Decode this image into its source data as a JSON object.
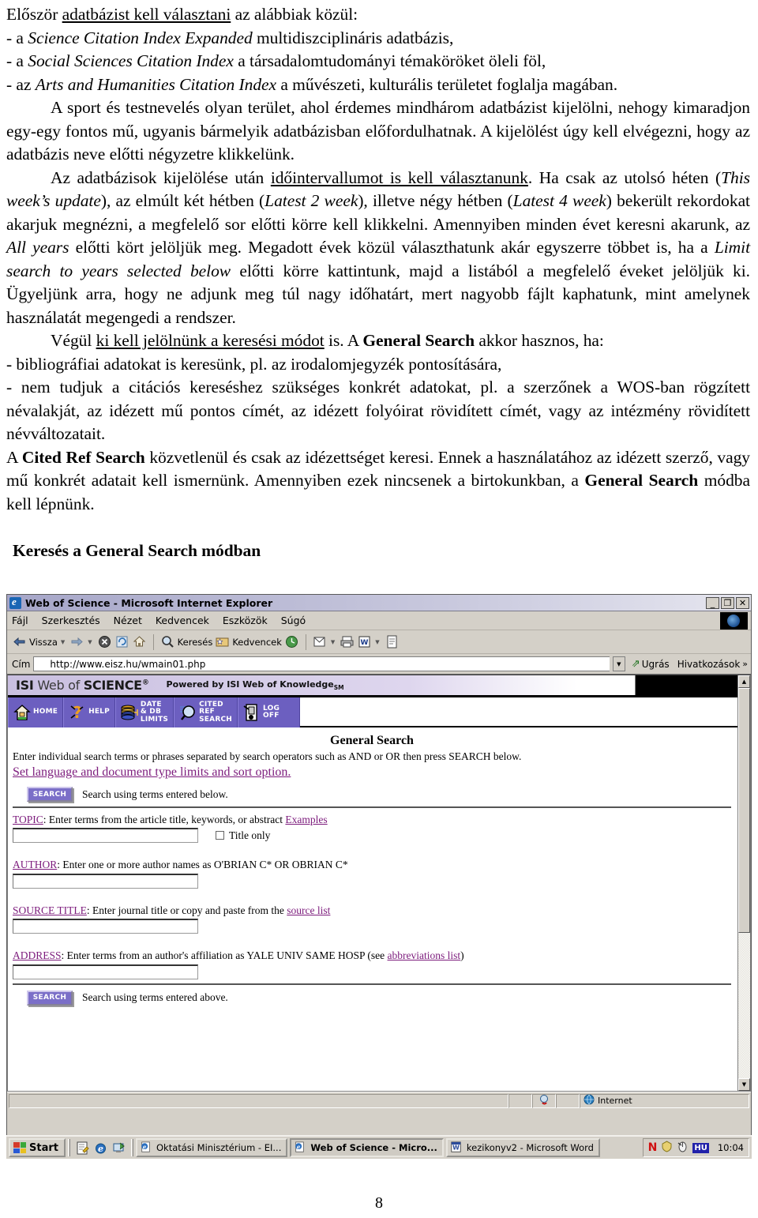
{
  "document": {
    "paragraphs": [
      {
        "id": "p1",
        "runs": [
          {
            "t": "Először ",
            "s": "n"
          },
          {
            "t": "adatbázist kell választani",
            "s": "u"
          },
          {
            "t": " az alábbiak közül:",
            "s": "n"
          }
        ]
      },
      {
        "id": "p2",
        "runs": [
          {
            "t": "- a ",
            "s": "n"
          },
          {
            "t": "Science Citation Index Expanded",
            "s": "i"
          },
          {
            "t": " multidiszciplináris adatbázis,",
            "s": "n"
          }
        ]
      },
      {
        "id": "p3",
        "runs": [
          {
            "t": "- a ",
            "s": "n"
          },
          {
            "t": "Social Sciences Citation Index",
            "s": "i"
          },
          {
            "t": " a társadalomtudományi témaköröket öleli föl,",
            "s": "n"
          }
        ]
      },
      {
        "id": "p4",
        "runs": [
          {
            "t": "- az ",
            "s": "n"
          },
          {
            "t": "Arts and Humanities Citation Index",
            "s": "i"
          },
          {
            "t": " a művészeti, kulturális területet foglalja magában.",
            "s": "n"
          }
        ]
      },
      {
        "id": "p5",
        "indent": true,
        "runs": [
          {
            "t": "A sport és testnevelés olyan terület, ahol érdemes mindhárom adatbázist kijelölni, nehogy kimaradjon egy-egy fontos mű, ugyanis bármelyik adatbázisban előfordulhatnak. A kijelölést úgy kell elvégezni, hogy az adatbázis neve előtti négyzetre klikkelünk.",
            "s": "n"
          }
        ]
      },
      {
        "id": "p6",
        "indent": true,
        "runs": [
          {
            "t": "Az adatbázisok kijelölése után ",
            "s": "n"
          },
          {
            "t": "időintervallumot is kell választanunk",
            "s": "u"
          },
          {
            "t": ". Ha csak az utolsó héten (",
            "s": "n"
          },
          {
            "t": "This week’s update",
            "s": "i"
          },
          {
            "t": "), az elmúlt két hétben (",
            "s": "n"
          },
          {
            "t": "Latest 2 week",
            "s": "i"
          },
          {
            "t": "), illetve négy hétben (",
            "s": "n"
          },
          {
            "t": "Latest 4 week",
            "s": "i"
          },
          {
            "t": ") bekerült rekordokat akarjuk megnézni, a megfelelő sor előtti körre kell klikkelni. Amennyiben minden évet keresni akarunk, az ",
            "s": "n"
          },
          {
            "t": "All years",
            "s": "i"
          },
          {
            "t": " előtti kört jelöljük meg. Megadott évek közül választhatunk akár egyszerre többet is, ha a ",
            "s": "n"
          },
          {
            "t": "Limit search to years selected below",
            "s": "i"
          },
          {
            "t": " előtti körre kattintunk, majd a listából a megfelelő éveket jelöljük ki. Ügyeljünk arra, hogy ne adjunk meg túl nagy időhatárt, mert nagyobb fájlt kaphatunk, mint amelynek használatát megengedi a rendszer.",
            "s": "n"
          }
        ]
      },
      {
        "id": "p7",
        "indent": true,
        "runs": [
          {
            "t": "Végül ",
            "s": "n"
          },
          {
            "t": "ki kell jelölnünk a keresési módot",
            "s": "u"
          },
          {
            "t": " is. A ",
            "s": "n"
          },
          {
            "t": "General Search",
            "s": "b"
          },
          {
            "t": " akkor hasznos, ha:",
            "s": "n"
          }
        ]
      },
      {
        "id": "p8",
        "runs": [
          {
            "t": "- bibliográfiai adatokat is keresünk, pl. az irodalomjegyzék pontosítására,",
            "s": "n"
          }
        ]
      },
      {
        "id": "p9",
        "runs": [
          {
            "t": "- nem tudjuk a citációs kereséshez szükséges konkrét adatokat, pl. a szerzőnek a WOS-ban rögzített névalakját, az idézett mű pontos címét, az idézett folyóirat rövidített címét, vagy az intézmény rövidített névváltozatait.",
            "s": "n"
          }
        ]
      },
      {
        "id": "p10",
        "runs": [
          {
            "t": "A ",
            "s": "n"
          },
          {
            "t": "Cited Ref Search",
            "s": "b"
          },
          {
            "t": " közvetlenül és csak az idézettséget keresi. Ennek a használatához az idézett szerző, vagy mű konkrét adatait kell ismernünk. Amennyiben ezek nincsenek a birtokunkban, a ",
            "s": "n"
          },
          {
            "t": "General Search",
            "s": "b"
          },
          {
            "t": " módba kell lépnünk.",
            "s": "n"
          }
        ]
      }
    ],
    "section_heading": "Keresés a General Search módban",
    "page_number": "8"
  },
  "browser": {
    "title": "Web of Science - Microsoft Internet Explorer",
    "window_buttons": {
      "minimize": "_",
      "restore": "❐",
      "close": "✕"
    },
    "menus": [
      "Fájl",
      "Szerkesztés",
      "Nézet",
      "Kedvencek",
      "Eszközök",
      "Súgó"
    ],
    "toolbar": [
      {
        "name": "back-button",
        "label": "Vissza",
        "icon": "arrow-left-icon",
        "dropdown": true
      },
      {
        "name": "forward-button",
        "label": "",
        "icon": "arrow-right-icon",
        "dropdown": true
      },
      {
        "name": "stop-button",
        "label": "",
        "icon": "stop-icon",
        "dropdown": false
      },
      {
        "name": "refresh-button",
        "label": "",
        "icon": "refresh-icon",
        "dropdown": false
      },
      {
        "name": "home-button",
        "label": "",
        "icon": "home-icon",
        "dropdown": false
      },
      {
        "name": "search-button",
        "label": "Keresés",
        "icon": "search-icon",
        "dropdown": false
      },
      {
        "name": "favorites-button",
        "label": "Kedvencek",
        "icon": "star-folder-icon",
        "dropdown": false
      },
      {
        "name": "history-button",
        "label": "",
        "icon": "history-icon",
        "dropdown": false
      },
      {
        "name": "mail-button",
        "label": "",
        "icon": "mail-icon",
        "dropdown": true
      },
      {
        "name": "print-button",
        "label": "",
        "icon": "printer-icon",
        "dropdown": false
      },
      {
        "name": "edit-word-button",
        "label": "",
        "icon": "word-icon",
        "dropdown": true
      },
      {
        "name": "discuss-button",
        "label": "",
        "icon": "page-icon",
        "dropdown": false
      }
    ],
    "address": {
      "label": "Cím",
      "value": "http://www.eisz.hu/wmain01.php",
      "go_label": "Ugrás",
      "links_label": "Hivatkozások"
    },
    "statusbar": {
      "message": "",
      "zone": "Internet"
    }
  },
  "wos": {
    "brand_isi": "ISI",
    "brand_web_of": " Web of ",
    "brand_science": "SCIENCE",
    "brand_reg": "®",
    "powered_by": "Powered by ISI Web of Knowledge",
    "powered_sm": "SM",
    "nav": [
      {
        "name": "home",
        "label": "HOME",
        "icon": "home-icon"
      },
      {
        "name": "help",
        "label": "HELP",
        "icon": "question-mark-icon"
      },
      {
        "name": "date-db-limits",
        "label": "DATE\n& DB\nLIMITS",
        "label_lines": [
          "DATE",
          "& DB",
          "LIMITS"
        ],
        "icon": "database-icon"
      },
      {
        "name": "cited-ref-search",
        "label_lines": [
          "CITED",
          "REF",
          "SEARCH"
        ],
        "icon": "magnifier-icon"
      },
      {
        "name": "log-off",
        "label": "LOG OFF",
        "icon": "door-exit-icon"
      }
    ],
    "page_title": "General Search",
    "instruction": "Enter individual search terms or phrases separated by search operators such as AND or OR then press SEARCH below.",
    "limits_link": "Set language and document type limits and sort option.",
    "search_button_top": {
      "label": "SEARCH",
      "note": "Search using terms entered below."
    },
    "search_button_bottom": {
      "label": "SEARCH",
      "note": "Search using terms entered above."
    },
    "fields": [
      {
        "name": "topic",
        "key": "TOPIC",
        "desc": ": Enter terms from the article title, keywords, or abstract ",
        "link": "Examples",
        "link_trail": "",
        "value": "",
        "checkbox": {
          "label": "Title only",
          "checked": false
        }
      },
      {
        "name": "author",
        "key": "AUTHOR",
        "desc": ": Enter one or more author names as O'BRIAN C* OR OBRIAN C*",
        "link": "",
        "link_trail": "",
        "value": "",
        "checkbox": null
      },
      {
        "name": "source-title",
        "key": "SOURCE TITLE",
        "desc": ": Enter journal title or copy and paste from the ",
        "link": "source list",
        "link_trail": "",
        "value": "",
        "checkbox": null
      },
      {
        "name": "address",
        "key": "ADDRESS",
        "desc": ": Enter terms from an author's affiliation as YALE UNIV SAME HOSP (see ",
        "link": "abbreviations list",
        "link_trail": ")",
        "value": "",
        "checkbox": null
      }
    ]
  },
  "taskbar": {
    "start_label": "Start",
    "quick_launch": [
      "notepad-icon",
      "internet-explorer-icon",
      "show-desktop-icon"
    ],
    "tasks": [
      {
        "label": "Oktatási Minisztérium - EI...",
        "icon": "internet-explorer-icon",
        "active": false
      },
      {
        "label": "Web of Science - Micro...",
        "icon": "internet-explorer-icon",
        "active": true
      },
      {
        "label": "kezikonyv2 - Microsoft Word",
        "icon": "word-icon",
        "active": false
      }
    ],
    "tray": {
      "icons": [
        "norton-icon",
        "shield-icon",
        "mouse-icon"
      ],
      "lang": "HU",
      "clock": "10:04"
    }
  },
  "colors": {
    "wos_purple": "#6c5fc0",
    "wos_link": "#7c1b7c",
    "brand_lavender": "#c9bfe0",
    "chrome_gray": "#d4d0c8",
    "title_gradient_start": "#a6a6c8"
  }
}
